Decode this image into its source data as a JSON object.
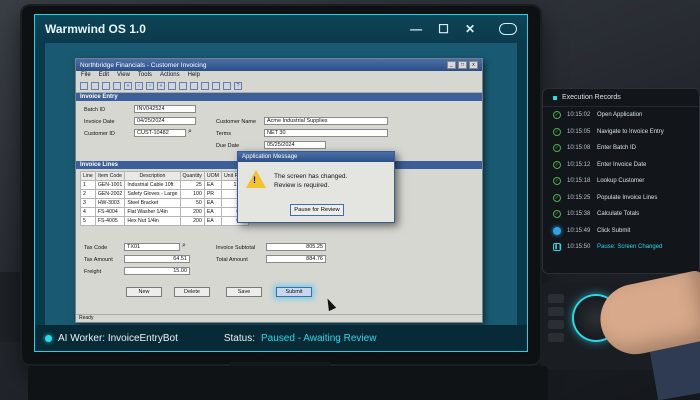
{
  "os": {
    "title": "Warmwind OS 1.0",
    "minimize": "—",
    "maximize": "☐",
    "close": "✕"
  },
  "app": {
    "title": "Northbridge Financials - Customer Invoicing",
    "menu": [
      "File",
      "Edit",
      "View",
      "Tools",
      "Actions",
      "Help"
    ],
    "toolbar_icons": [
      "new-icon",
      "open-icon",
      "save-icon",
      "print-icon",
      "first-icon",
      "prev-icon",
      "next-icon",
      "last-icon",
      "find-icon",
      "copy-icon",
      "cut-icon",
      "paste-icon",
      "undo-icon",
      "delete-icon",
      "help-icon"
    ],
    "invoice_entry": {
      "header": "Invoice Entry",
      "batch_id_label": "Batch ID",
      "batch_id": "INV042524",
      "invoice_date_label": "Invoice Date",
      "invoice_date": "04/25/2024",
      "customer_id_label": "Customer ID",
      "customer_id": "CUST-10482",
      "customer_name_label": "Customer Name",
      "customer_name": "Acme Industrial Supplies",
      "terms_label": "Terms",
      "terms": "NET 30",
      "due_date_label": "Due Date",
      "due_date": "05/25/2024"
    },
    "invoice_lines": {
      "header": "Invoice Lines",
      "columns": [
        "Line",
        "Item Code",
        "Description",
        "Quantity",
        "UOM",
        "Unit Price"
      ],
      "rows": [
        [
          "1",
          "GEN-1001",
          "Industrial Cable 10ft",
          "25",
          "EA",
          "12.75"
        ],
        [
          "2",
          "GEN-2002",
          "Safety Gloves - Large",
          "100",
          "PR",
          "2.40"
        ],
        [
          "3",
          "HW-3003",
          "Steel Bracket",
          "50",
          "EA",
          "3.85"
        ],
        [
          "4",
          "FS-4004",
          "Flat Washer 1/4in",
          "200",
          "EA",
          "0.15"
        ],
        [
          "5",
          "FS-4005",
          "Hex Nut 1/4in",
          "200",
          "EA",
          "0.12"
        ]
      ]
    },
    "totals": {
      "tax_code_label": "Tax Code",
      "tax_code": "TX01",
      "tax_amount_label": "Tax Amount",
      "tax_amount": "64.51",
      "freight_label": "Freight",
      "freight": "15.00",
      "subtotal_label": "Invoice Subtotal",
      "subtotal": "805.25",
      "total_label": "Total Amount",
      "total": "884.76"
    },
    "buttons": {
      "new": "New",
      "delete": "Delete",
      "save": "Save",
      "submit": "Submit"
    },
    "status": "Ready"
  },
  "dialog": {
    "title": "Application Message",
    "line1": "The screen has changed.",
    "line2": "Review is required.",
    "button": "Pause for Review"
  },
  "bottombar": {
    "worker": "AI Worker: InvoiceEntryBot",
    "status_label": "Status:",
    "status_value": "Paused - Awaiting Review"
  },
  "records": {
    "title": "Execution Records",
    "items": [
      {
        "time": "10:15:02",
        "label": "Open Application",
        "state": "done"
      },
      {
        "time": "10:15:05",
        "label": "Navigate to Invoice Entry",
        "state": "done"
      },
      {
        "time": "10:15:08",
        "label": "Enter Batch ID",
        "state": "done"
      },
      {
        "time": "10:15:12",
        "label": "Enter Invoice Date",
        "state": "done"
      },
      {
        "time": "10:15:18",
        "label": "Lookup Customer",
        "state": "done"
      },
      {
        "time": "10:15:25",
        "label": "Populate Invoice Lines",
        "state": "done"
      },
      {
        "time": "10:15:38",
        "label": "Calculate Totals",
        "state": "done"
      },
      {
        "time": "10:15:49",
        "label": "Click Submit",
        "state": "current"
      },
      {
        "time": "10:15:50",
        "label": "Pause: Screen Changed",
        "state": "paused"
      }
    ]
  }
}
